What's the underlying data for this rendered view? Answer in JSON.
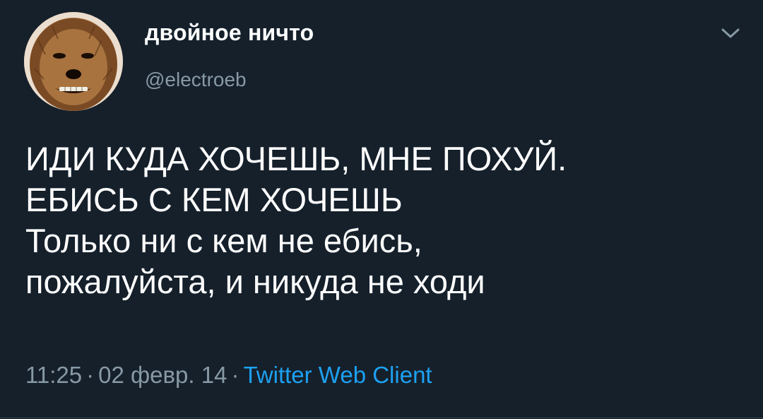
{
  "tweet": {
    "author": {
      "display_name": "двойное ничто",
      "handle": "@electroeb",
      "avatar_icon": "wookiee-avatar"
    },
    "menu_icon": "chevron-down-icon",
    "text_lines": [
      "ИДИ КУДА ХОЧЕШЬ, МНЕ ПОХУЙ.",
      "ЕБИСЬ С КЕМ ХОЧЕШЬ",
      "Только ни с кем не ебись,",
      "пожалуйста, и никуда не ходи"
    ],
    "time": "11:25",
    "date": "02 февр. 14",
    "separator": "·",
    "source": "Twitter Web Client"
  },
  "colors": {
    "background": "#15202b",
    "text_primary": "#ffffff",
    "text_secondary": "#8899a6",
    "link": "#1da1f2"
  }
}
